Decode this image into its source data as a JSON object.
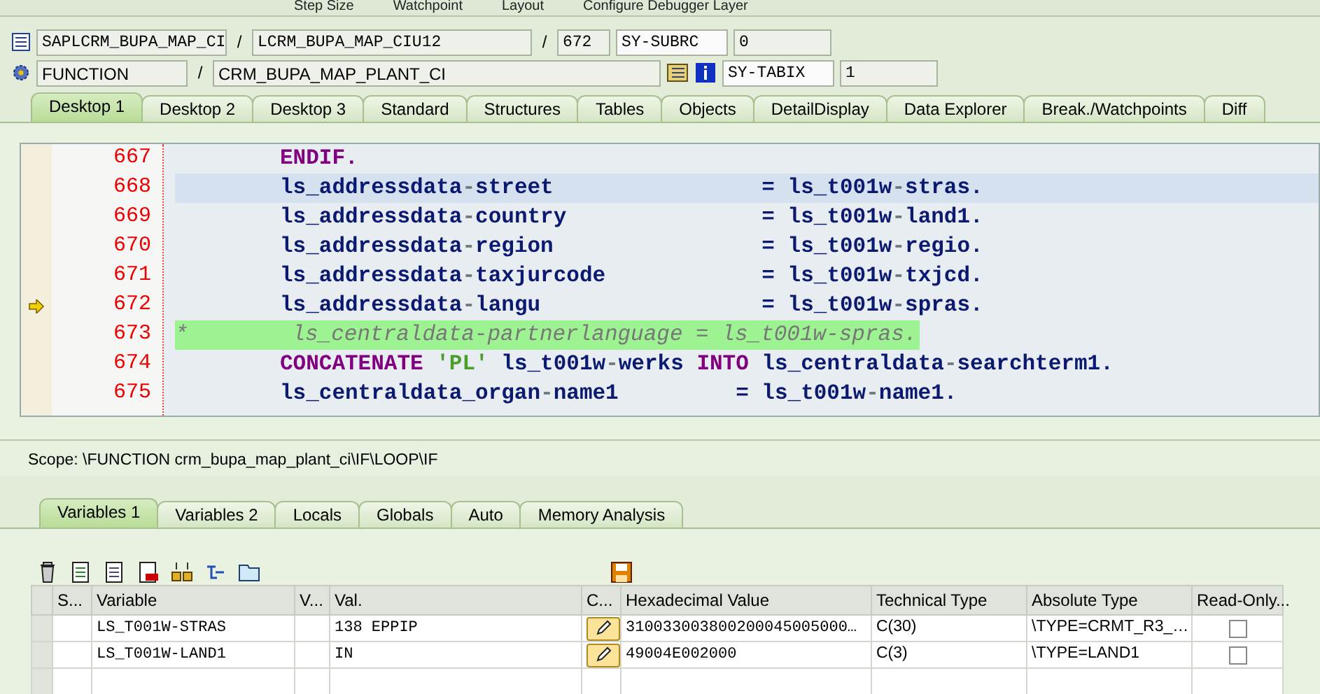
{
  "toolbar": [
    "Step Size",
    "Watchpoint",
    "Layout",
    "Configure Debugger Layer"
  ],
  "context": {
    "separators": [
      "/",
      "/",
      "/"
    ],
    "program": "SAPLCRM_BUPA_MAP_CI",
    "include": "LCRM_BUPA_MAP_CIU12",
    "line": "672",
    "event_type": "FUNCTION",
    "event": "CRM_BUPA_MAP_PLANT_CI",
    "sysfields": [
      {
        "name": "SY-SUBRC",
        "value": "0"
      },
      {
        "name": "SY-TABIX",
        "value": "1"
      }
    ]
  },
  "desktop_tabs": [
    {
      "label": "Desktop 1",
      "selected": true
    },
    {
      "label": "Desktop 2",
      "selected": false
    },
    {
      "label": "Desktop 3",
      "selected": false
    },
    {
      "label": "Standard",
      "selected": false
    },
    {
      "label": "Structures",
      "selected": false
    },
    {
      "label": "Tables",
      "selected": false
    },
    {
      "label": "Objects",
      "selected": false
    },
    {
      "label": "DetailDisplay",
      "selected": false
    },
    {
      "label": "Data Explorer",
      "selected": false
    },
    {
      "label": "Break./Watchpoints",
      "selected": false
    },
    {
      "label": "Diff",
      "selected": false
    }
  ],
  "code_lines": [
    {
      "number": "667",
      "current": false,
      "highlighted": false,
      "comment": false,
      "indented": true,
      "segments": [
        {
          "kind": "kw",
          "text": "ENDIF."
        }
      ]
    },
    {
      "number": "668",
      "current": false,
      "highlighted": true,
      "comment": false,
      "indented": true,
      "segments": [
        {
          "kind": "id",
          "text": "ls_addressdata"
        },
        {
          "kind": "op",
          "text": "-"
        },
        {
          "kind": "id",
          "text": "street                = ls_t001w"
        },
        {
          "kind": "op",
          "text": "-"
        },
        {
          "kind": "id",
          "text": "stras."
        }
      ]
    },
    {
      "number": "669",
      "current": false,
      "highlighted": false,
      "comment": false,
      "indented": true,
      "segments": [
        {
          "kind": "id",
          "text": "ls_addressdata"
        },
        {
          "kind": "op",
          "text": "-"
        },
        {
          "kind": "id",
          "text": "country               = ls_t001w"
        },
        {
          "kind": "op",
          "text": "-"
        },
        {
          "kind": "id",
          "text": "land1."
        }
      ]
    },
    {
      "number": "670",
      "current": false,
      "highlighted": false,
      "comment": false,
      "indented": true,
      "segments": [
        {
          "kind": "id",
          "text": "ls_addressdata"
        },
        {
          "kind": "op",
          "text": "-"
        },
        {
          "kind": "id",
          "text": "region                = ls_t001w"
        },
        {
          "kind": "op",
          "text": "-"
        },
        {
          "kind": "id",
          "text": "regio."
        }
      ]
    },
    {
      "number": "671",
      "current": false,
      "highlighted": false,
      "comment": false,
      "indented": true,
      "segments": [
        {
          "kind": "id",
          "text": "ls_addressdata"
        },
        {
          "kind": "op",
          "text": "-"
        },
        {
          "kind": "id",
          "text": "taxjurcode            = ls_t001w"
        },
        {
          "kind": "op",
          "text": "-"
        },
        {
          "kind": "id",
          "text": "txjcd."
        }
      ]
    },
    {
      "number": "672",
      "current": true,
      "highlighted": false,
      "comment": false,
      "indented": true,
      "segments": [
        {
          "kind": "id",
          "text": "ls_addressdata"
        },
        {
          "kind": "op",
          "text": "-"
        },
        {
          "kind": "id",
          "text": "langu                 = ls_t001w"
        },
        {
          "kind": "op",
          "text": "-"
        },
        {
          "kind": "id",
          "text": "spras."
        }
      ]
    },
    {
      "number": "673",
      "current": false,
      "highlighted": false,
      "comment": true,
      "indented": false,
      "segments": [
        {
          "kind": "cmt",
          "text": "*        ls_centraldata-partnerlanguage = ls_t001w-spras."
        }
      ]
    },
    {
      "number": "674",
      "current": false,
      "highlighted": false,
      "comment": false,
      "indented": true,
      "segments": [
        {
          "kind": "kw",
          "text": "CONCATENATE "
        },
        {
          "kind": "str",
          "text": "'PL'"
        },
        {
          "kind": "id",
          "text": " ls_t001w"
        },
        {
          "kind": "op",
          "text": "-"
        },
        {
          "kind": "id",
          "text": "werks "
        },
        {
          "kind": "kw",
          "text": "INTO"
        },
        {
          "kind": "id",
          "text": " ls_centraldata"
        },
        {
          "kind": "op",
          "text": "-"
        },
        {
          "kind": "id",
          "text": "searchterm1."
        }
      ]
    },
    {
      "number": "675",
      "current": false,
      "highlighted": false,
      "comment": false,
      "indented": true,
      "segments": [
        {
          "kind": "id",
          "text": "ls_centraldata_organ"
        },
        {
          "kind": "op",
          "text": "-"
        },
        {
          "kind": "id",
          "text": "name1         = ls_t001w"
        },
        {
          "kind": "op",
          "text": "-"
        },
        {
          "kind": "id",
          "text": "name1."
        }
      ]
    }
  ],
  "scope": "Scope: \\FUNCTION crm_bupa_map_plant_ci\\IF\\LOOP\\IF",
  "variable_tabs": [
    {
      "label": "Variables 1",
      "selected": true
    },
    {
      "label": "Variables 2",
      "selected": false
    },
    {
      "label": "Locals",
      "selected": false
    },
    {
      "label": "Globals",
      "selected": false
    },
    {
      "label": "Auto",
      "selected": false
    },
    {
      "label": "Memory Analysis",
      "selected": false
    }
  ],
  "table": {
    "columns": [
      "S...",
      "Variable",
      "V...",
      "Val.",
      "C...",
      "Hexadecimal Value",
      "Technical Type",
      "Absolute Type",
      "Read-Only..."
    ],
    "rows": [
      {
        "variable": "LS_T001W-STRAS",
        "value": "138 EPPIP",
        "hex": "310033003800200045005000…",
        "technical_type": "C(30)",
        "absolute_type": "\\TYPE=CRMT_R3_…",
        "read_only": false
      },
      {
        "variable": "LS_T001W-LAND1",
        "value": "IN",
        "hex": "49004E002000",
        "technical_type": "C(3)",
        "absolute_type": "\\TYPE=LAND1",
        "read_only": false
      }
    ]
  }
}
